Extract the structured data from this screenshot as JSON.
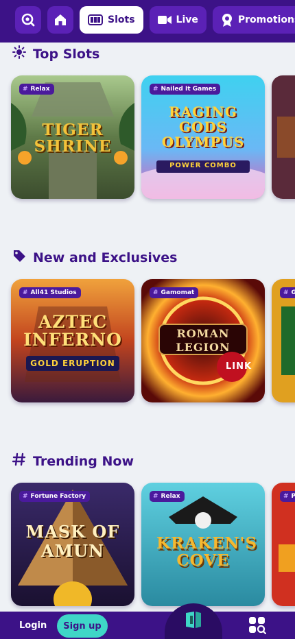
{
  "nav": {
    "tabs": [
      {
        "label": "",
        "icon": "search-icon"
      },
      {
        "label": "",
        "icon": "home-icon"
      },
      {
        "label": "Slots",
        "icon": "slot-machine-icon",
        "active": true
      },
      {
        "label": "Live",
        "icon": "video-camera-icon"
      },
      {
        "label": "Promotions",
        "icon": "badge-star-icon"
      }
    ]
  },
  "sections": [
    {
      "title": "Top Slots",
      "icon": "sun-icon",
      "games": [
        {
          "provider": "Relax",
          "title": "TIGER SHRINE"
        },
        {
          "provider": "Nailed It Games",
          "title": "RAGING GODS OLYMPUS",
          "subtitle": "POWER COMBO"
        },
        {
          "provider": "",
          "title": ""
        }
      ]
    },
    {
      "title": "New and Exclusives",
      "icon": "tag-icon",
      "games": [
        {
          "provider": "All41 Studios",
          "title": "AZTEC INFERNO",
          "subtitle": "GOLD ERUPTION"
        },
        {
          "provider": "Gamomat",
          "title": "ROMAN LEGION",
          "subtitle": "LINK"
        },
        {
          "provider": "G",
          "title": ""
        }
      ]
    },
    {
      "title": "Trending Now",
      "icon": "hash-icon",
      "games": [
        {
          "provider": "Fortune Factory",
          "title": "MASK OF AMUN"
        },
        {
          "provider": "Relax",
          "title": "KRAKEN'S COVE"
        },
        {
          "provider": "P",
          "title": ""
        }
      ]
    }
  ],
  "bottom": {
    "login_label": "Login",
    "signup_label": "Sign up"
  },
  "colors": {
    "brand": "#3c1287",
    "accent": "#3fd6c7",
    "background": "#eef1f5"
  }
}
